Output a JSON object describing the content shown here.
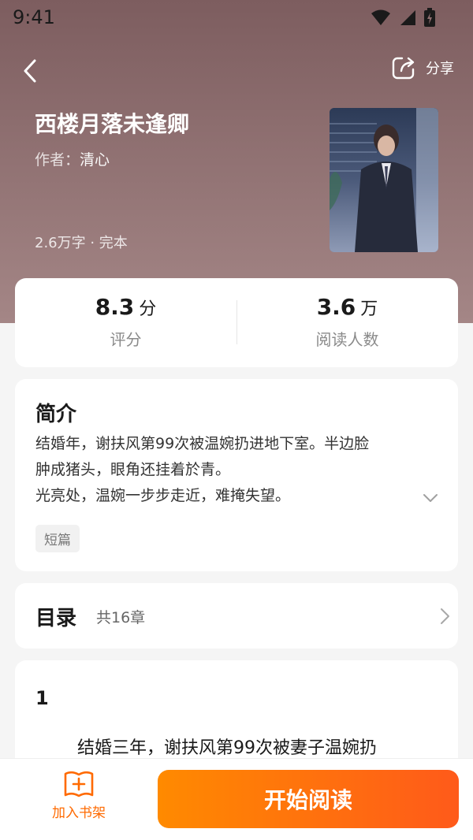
{
  "status": {
    "time": "9:41"
  },
  "header": {
    "share_label": "分享"
  },
  "book": {
    "title": "西楼月落未逢卿",
    "author_label": "作者：",
    "author_name": "清心",
    "meta": "2.6万字 · 完本"
  },
  "stats": {
    "rating": {
      "value": "8.3",
      "unit": "分",
      "label": "评分"
    },
    "readers": {
      "value": "3.6",
      "unit": "万",
      "label": "阅读人数"
    }
  },
  "intro": {
    "title": "简介",
    "lines": [
      "结婚年，谢扶风第99次被温婉扔进地下室。半边脸",
      "肿成猪头，眼角还挂着於青。",
      "光亮处，温婉一步步走近，难掩失望。"
    ],
    "tag": "短篇"
  },
  "toc": {
    "title": "目录",
    "count": "共16章"
  },
  "chapter": {
    "number": "1",
    "first_line": "结婚三年，谢扶风第99次被妻子温婉扔"
  },
  "bottom": {
    "shelf_label": "加入书架",
    "read_label": "开始阅读"
  },
  "colors": {
    "accent": "#ff6a00",
    "hero_top": "#7d5d5f",
    "hero_bottom": "#a48686"
  }
}
